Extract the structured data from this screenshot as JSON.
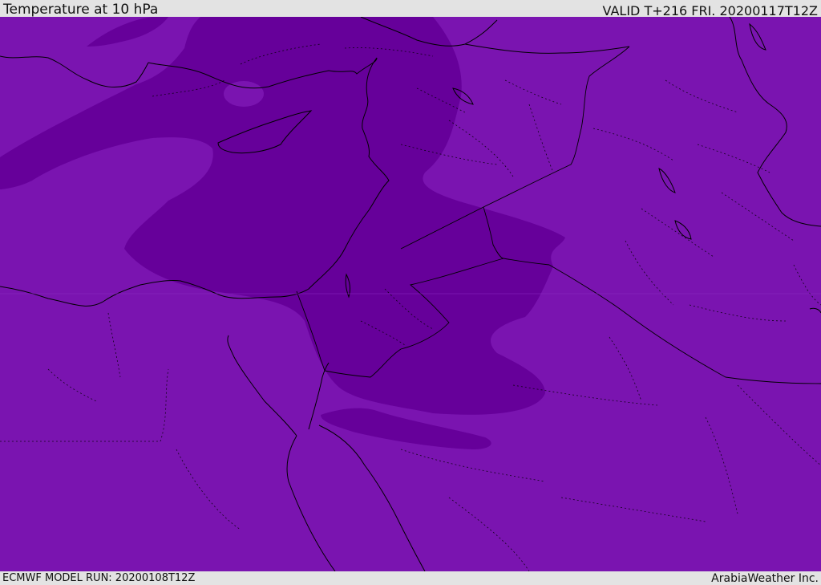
{
  "header": {
    "title": "Temperature at 10 hPa",
    "valid_label": "VALID T+216 FRI. 20200117T12Z"
  },
  "footer": {
    "model_run": "ECMWF MODEL RUN: 20200108T12Z",
    "credit": "ArabiaWeather Inc."
  },
  "colors": {
    "light_fill": "#7a14b0",
    "dark_fill": "#66009a",
    "coast": "#000000",
    "bar_background": "#e3e3e3"
  }
}
